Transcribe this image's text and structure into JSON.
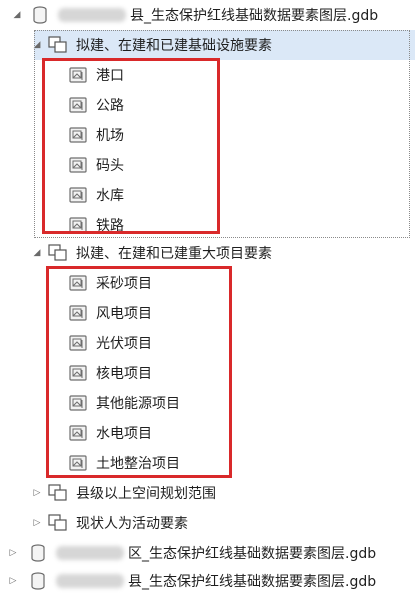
{
  "tree": {
    "db1": {
      "label": "县_生态保护红线基础数据要素图层.gdb"
    },
    "group1": {
      "label": "拟建、在建和已建基础设施要素",
      "items": [
        "港口",
        "公路",
        "机场",
        "码头",
        "水库",
        "铁路"
      ]
    },
    "group2": {
      "label": "拟建、在建和已建重大项目要素",
      "items": [
        "采砂项目",
        "风电项目",
        "光伏项目",
        "核电项目",
        "其他能源项目",
        "水电项目",
        "土地整治项目"
      ]
    },
    "group3": {
      "label": "县级以上空间规划范围"
    },
    "group4": {
      "label": "现状人为活动要素"
    },
    "db2": {
      "label": "区_生态保护红线基础数据要素图层.gdb"
    },
    "db3": {
      "label": "县_生态保护红线基础数据要素图层.gdb"
    }
  },
  "colors": {
    "selection": "#dbe8f7",
    "highlight_box": "#d9292a"
  }
}
